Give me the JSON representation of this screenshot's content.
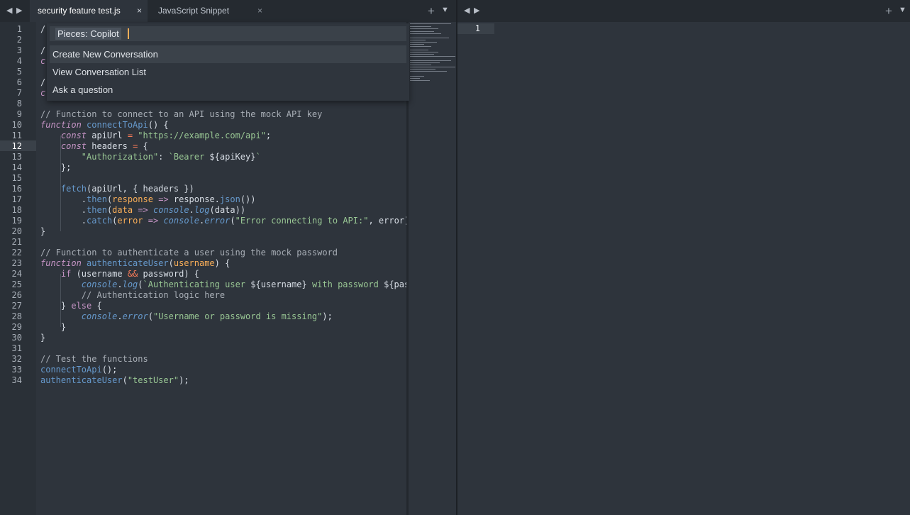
{
  "left_tabs": {
    "active_label": "security feature test.js",
    "inactive_label": "JavaScript Snippet",
    "close_glyph": "×",
    "prev_glyph": "◀",
    "next_glyph": "▶",
    "new_tab_glyph": "+",
    "menu_glyph": "▼"
  },
  "right_tabs": {
    "prev_glyph": "◀",
    "next_glyph": "▶",
    "new_tab_glyph": "+",
    "menu_glyph": "▼"
  },
  "editor": {
    "line_numbers": [
      "1",
      "2",
      "3",
      "4",
      "5",
      "6",
      "7",
      "8",
      "9",
      "10",
      "11",
      "12",
      "13",
      "14",
      "15",
      "16",
      "17",
      "18",
      "19",
      "20",
      "21",
      "22",
      "23",
      "24",
      "25",
      "26",
      "27",
      "28",
      "29",
      "30",
      "31",
      "32",
      "33",
      "34"
    ],
    "current_line": "12",
    "partial_lines": {
      "l1": "/",
      "l3": "/",
      "l4": "c",
      "l6": "/",
      "l7": "c"
    }
  },
  "right_editor": {
    "line_number": "1"
  },
  "palette": {
    "input_value": "Pieces: Copilot",
    "items": [
      "Create New Conversation",
      "View Conversation List",
      "Ask a question"
    ]
  },
  "colors": {
    "background": "#2e343c",
    "comment": "#a8aeb6",
    "keyword": "#c594c5",
    "function": "#6699cc",
    "string": "#99c794",
    "operator": "#f97b58",
    "parameter": "#f9ae58"
  }
}
